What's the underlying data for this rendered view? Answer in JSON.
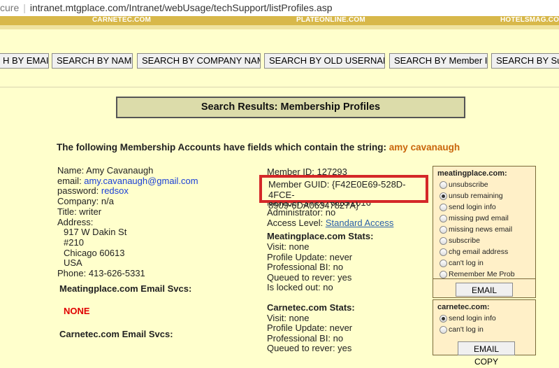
{
  "address": {
    "secure_text": "cure",
    "url": "intranet.mtgplace.com/Intranet/webUsage/techSupport/listProfiles.asp"
  },
  "topbar": {
    "links": [
      "CARNETEC.COM",
      "PLATEONLINE.COM",
      "HOTELSMAG.COM"
    ]
  },
  "search_buttons": [
    "H BY EMAIL",
    "SEARCH BY NAME",
    "SEARCH BY COMPANY NAME",
    "SEARCH BY OLD USERNAME",
    "SEARCH BY Member ID",
    "SEARCH BY Subs"
  ],
  "title": "Search Results: Membership Profiles",
  "intro": {
    "text": "The following Membership Accounts have fields which contain the string: ",
    "query": "amy cavanaugh"
  },
  "profile": {
    "name": "Name: Amy Cavanaugh",
    "email_label": "email: ",
    "email": "amy.cavanaugh@gmail.com",
    "password_label": "password: ",
    "password": "redsox",
    "company": "Company: n/a",
    "title": "Title: writer",
    "address_label": "Address:",
    "address_lines": [
      "917 W Dakin St",
      "#210",
      "Chicago 60613",
      "USA"
    ],
    "phone": "Phone: 413-626-5331"
  },
  "sections": {
    "meatingplace_email": "Meatingplace.com Email Svcs:",
    "none": "NONE",
    "carnetec_email": "Carnetec.com Email Svcs:"
  },
  "member": {
    "member_id": "Member ID: 127293",
    "guid_line1": "Member GUID: {F42E0E69-528D-4FCE-",
    "guid_line2": "8909-6DA06347827A}",
    "member_since": "Member Since: 6/16/2016",
    "administrator": "Administrator: no",
    "access_label": "Access Level: ",
    "access_value": "Standard Access"
  },
  "meatingplace_stats": {
    "header": "Meatingplace.com Stats:",
    "lines": [
      "Visit:  none",
      "Profile Update:  never",
      "Professional BI:  no",
      "Queued to rever:  yes",
      "Is locked out:  no"
    ]
  },
  "carnetec_stats": {
    "header": "Carnetec.com Stats:",
    "lines": [
      "Visit:  none",
      "Profile Update:  never",
      "Professional BI:  no",
      "Queued to rever:  yes"
    ]
  },
  "panel_meatingplace": {
    "header": "meatingplace.com:",
    "options": [
      "unsubscribe",
      "unsub remaining",
      "send login info",
      "missing pwd email",
      "missing news email",
      "subscribe",
      "chg email address",
      "can't log in",
      "Remember Me Prob"
    ],
    "selected_option": "unsub remaining",
    "button": "EMAIL COPY"
  },
  "panel_carnetec": {
    "header": "carnetec.com:",
    "options": [
      "send login info",
      "can't log in"
    ],
    "selected_option": "send login info",
    "button": "EMAIL COPY"
  },
  "colors": {
    "page_bg": "#ffffcc",
    "highlight_box": "#d42828",
    "query_color": "#c9650b",
    "none_color": "#e00000"
  }
}
